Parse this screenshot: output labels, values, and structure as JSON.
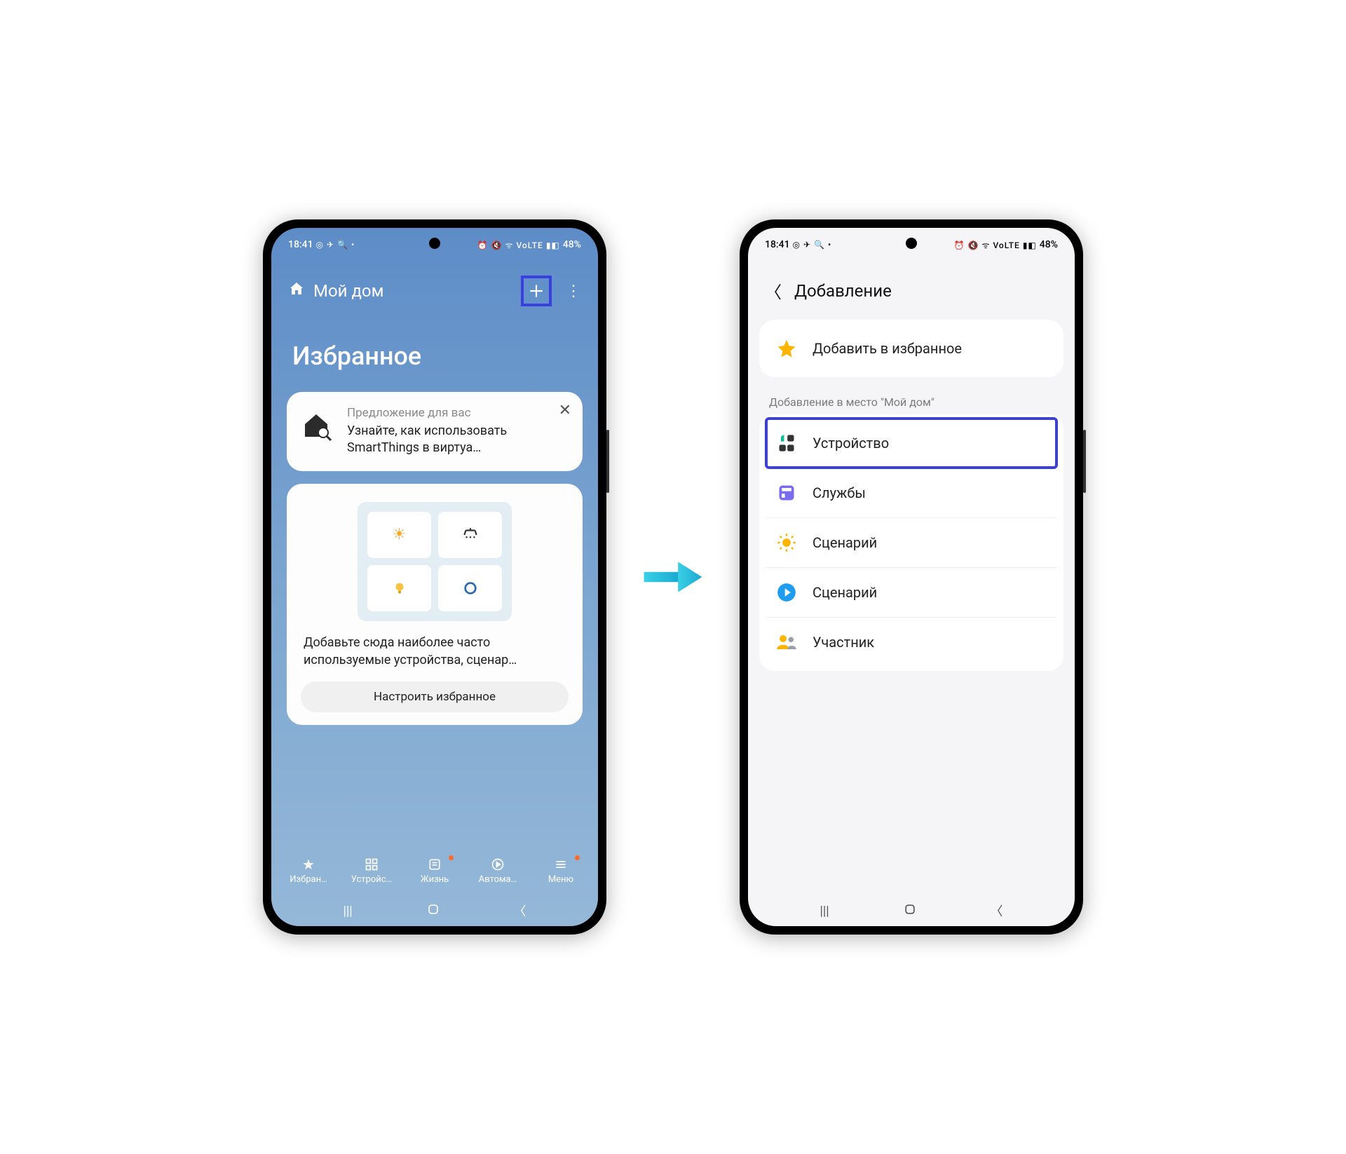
{
  "status": {
    "time": "18:41",
    "battery": "48%",
    "left_icons": "◎ ✈ 🔍 •",
    "right_icons": "⏰ 🔇 ᯤ VoLTE ▮◧"
  },
  "screen1": {
    "header": {
      "home_label": "Мой дом"
    },
    "favorites_title": "Избранное",
    "suggestion": {
      "label": "Предложение для вас",
      "text": "Узнайте, как использовать SmartThings в виртуа…"
    },
    "promo": {
      "text": "Добавьте сюда наиболее часто используемые устройства, сценар…",
      "button": "Настроить избранное"
    },
    "nav": {
      "favorites": "Избран…",
      "devices": "Устройс…",
      "life": "Жизнь",
      "automation": "Автома…",
      "menu": "Меню"
    }
  },
  "screen2": {
    "title": "Добавление",
    "fav_row": "Добавить в избранное",
    "section_label": "Добавление в место \"Мой дом\"",
    "rows": {
      "device": "Устройство",
      "services": "Службы",
      "scenario1": "Сценарий",
      "scenario2": "Сценарий",
      "member": "Участник"
    }
  }
}
